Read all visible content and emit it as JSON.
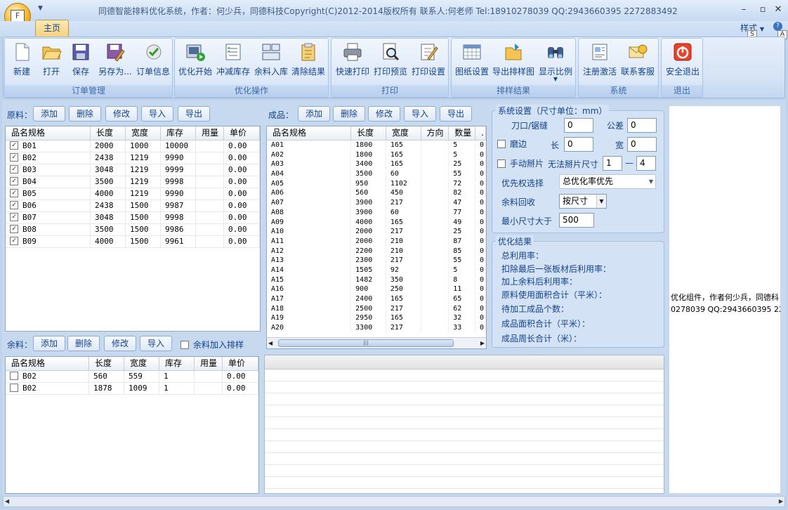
{
  "window": {
    "title": "同德智能排料优化系统，作者：何少兵，同德科技Copyright(C)2012-2014版权所有   联系人:何老师   Tel:18910278039  QQ:2943660395  2272883492",
    "orb_label": "F"
  },
  "tabs": {
    "home": "主页",
    "style_menu": "样式",
    "keytip_s": "S",
    "keytip_a": "A"
  },
  "ribbon": {
    "groups": [
      {
        "label": "订单管理",
        "buttons": [
          {
            "label": "新建",
            "icon": "new-file-icon"
          },
          {
            "label": "打开",
            "icon": "open-folder-icon"
          },
          {
            "label": "保存",
            "icon": "save-disk-icon"
          },
          {
            "label": "另存为...",
            "icon": "save-as-icon"
          },
          {
            "label": "订单信息",
            "icon": "order-info-icon"
          }
        ]
      },
      {
        "label": "优化操作",
        "buttons": [
          {
            "label": "优化开始",
            "icon": "optimize-start-icon"
          },
          {
            "label": "冲减库存",
            "icon": "reduce-stock-icon"
          },
          {
            "label": "余料入库",
            "icon": "remnant-stock-icon"
          },
          {
            "label": "清除结果",
            "icon": "clear-result-icon"
          }
        ]
      },
      {
        "label": "打印",
        "buttons": [
          {
            "label": "快速打印",
            "icon": "quick-print-icon"
          },
          {
            "label": "打印预览",
            "icon": "print-preview-icon"
          },
          {
            "label": "打印设置",
            "icon": "print-settings-icon"
          }
        ]
      },
      {
        "label": "排样结果",
        "buttons": [
          {
            "label": "图纸设置",
            "icon": "drawing-settings-icon"
          },
          {
            "label": "导出排样图",
            "icon": "export-layout-icon"
          },
          {
            "label": "显示比例",
            "icon": "zoom-scale-icon"
          }
        ]
      },
      {
        "label": "系统",
        "buttons": [
          {
            "label": "注册激活",
            "icon": "register-icon"
          },
          {
            "label": "联系客服",
            "icon": "contact-service-icon"
          }
        ]
      },
      {
        "label": "退出",
        "buttons": [
          {
            "label": "安全退出",
            "icon": "power-exit-icon"
          }
        ]
      }
    ]
  },
  "raw": {
    "label": "原料：",
    "buttons": [
      "添加",
      "删除",
      "修改",
      "导入",
      "导出"
    ],
    "columns": [
      "品名规格",
      "长度",
      "宽度",
      "库存",
      "用量",
      "单价"
    ],
    "rows": [
      {
        "checked": true,
        "cells": [
          "B01",
          "2000",
          "1000",
          "10000",
          "",
          "0.00"
        ]
      },
      {
        "checked": true,
        "cells": [
          "B02",
          "2438",
          "1219",
          "9990",
          "",
          "0.00"
        ]
      },
      {
        "checked": true,
        "cells": [
          "B03",
          "3048",
          "1219",
          "9999",
          "",
          "0.00"
        ]
      },
      {
        "checked": true,
        "cells": [
          "B04",
          "3500",
          "1219",
          "9998",
          "",
          "0.00"
        ]
      },
      {
        "checked": true,
        "cells": [
          "B05",
          "4000",
          "1219",
          "9990",
          "",
          "0.00"
        ]
      },
      {
        "checked": true,
        "cells": [
          "B06",
          "2438",
          "1500",
          "9987",
          "",
          "0.00"
        ]
      },
      {
        "checked": true,
        "cells": [
          "B07",
          "3048",
          "1500",
          "9998",
          "",
          "0.00"
        ]
      },
      {
        "checked": true,
        "cells": [
          "B08",
          "3500",
          "1500",
          "9986",
          "",
          "0.00"
        ]
      },
      {
        "checked": true,
        "cells": [
          "B09",
          "4000",
          "1500",
          "9961",
          "",
          "0.00"
        ]
      }
    ]
  },
  "remnant": {
    "label": "余料：",
    "buttons": [
      "添加",
      "删除",
      "修改",
      "导入"
    ],
    "add_to_layout": "余料加入排样",
    "columns": [
      "品名规格",
      "长度",
      "宽度",
      "库存",
      "用量",
      "单价"
    ],
    "rows": [
      {
        "checked": false,
        "cells": [
          "B02",
          "560",
          "559",
          "1",
          "",
          "0.00"
        ]
      },
      {
        "checked": false,
        "cells": [
          "B02",
          "1878",
          "1009",
          "1",
          "",
          "0.00"
        ]
      }
    ]
  },
  "product": {
    "label": "成品：",
    "buttons": [
      "添加",
      "删除",
      "修改",
      "导入",
      "导出"
    ],
    "columns": [
      "品名规格",
      "长度",
      "宽度",
      "方向",
      "数量",
      "."
    ],
    "rows": [
      [
        "A01",
        "1800",
        "165",
        "",
        "5",
        "0"
      ],
      [
        "A02",
        "1800",
        "165",
        "",
        "5",
        "0"
      ],
      [
        "A03",
        "3400",
        "165",
        "",
        "25",
        "0"
      ],
      [
        "A04",
        "3500",
        "60",
        "",
        "55",
        "0"
      ],
      [
        "A05",
        "950",
        "1102",
        "",
        "72",
        "0"
      ],
      [
        "A06",
        "560",
        "450",
        "",
        "82",
        "0"
      ],
      [
        "A07",
        "3900",
        "217",
        "",
        "47",
        "0"
      ],
      [
        "A08",
        "3900",
        "60",
        "",
        "77",
        "0"
      ],
      [
        "A09",
        "4000",
        "165",
        "",
        "49",
        "0"
      ],
      [
        "A10",
        "2000",
        "217",
        "",
        "25",
        "0"
      ],
      [
        "A11",
        "2000",
        "210",
        "",
        "87",
        "0"
      ],
      [
        "A12",
        "2200",
        "210",
        "",
        "85",
        "0"
      ],
      [
        "A13",
        "2300",
        "217",
        "",
        "55",
        "0"
      ],
      [
        "A14",
        "1505",
        "92",
        "",
        "5",
        "0"
      ],
      [
        "A15",
        "1482",
        "350",
        "",
        "8",
        "0"
      ],
      [
        "A16",
        "900",
        "250",
        "",
        "11",
        "0"
      ],
      [
        "A17",
        "2400",
        "165",
        "",
        "65",
        "0"
      ],
      [
        "A18",
        "2500",
        "217",
        "",
        "62",
        "0"
      ],
      [
        "A19",
        "2950",
        "165",
        "",
        "32",
        "0"
      ],
      [
        "A20",
        "3300",
        "217",
        "",
        "33",
        "0"
      ]
    ],
    "scroll_thumb": "|||"
  },
  "settings": {
    "title": "系统设置（尺寸单位：mm）",
    "blade_label": "刀口/锯缝",
    "blade_value": "0",
    "tolerance_label": "公差",
    "tolerance_value": "0",
    "trim_label": "磨边",
    "length_label": "长",
    "length_value": "0",
    "width_label": "宽",
    "width_value": "0",
    "manual_flip_label": "手动掰片",
    "unflippable_label": "无法掰片尺寸",
    "unflippable_from": "1",
    "dash": "—",
    "unflippable_to": "4",
    "priority_label": "优先权选择",
    "priority_value": "总优化率优先",
    "recycle_label": "余料回收",
    "recycle_value": "按尺寸",
    "min_size_label": "最小尺寸大于",
    "min_size_value": "500"
  },
  "results": {
    "title": "优化结果",
    "lines": [
      "总利用率：",
      "扣除最后一张板材后利用率：",
      "加上余料后利用率：",
      "原料使用面积合计（平米）：",
      "待加工成品个数：",
      "成品面积合计（平米）：",
      "成品周长合计（米）："
    ]
  },
  "right_panel": {
    "line1": "优化组件，作者何少兵，同德科",
    "line2": "0278039  QQ:2943660395  227"
  }
}
